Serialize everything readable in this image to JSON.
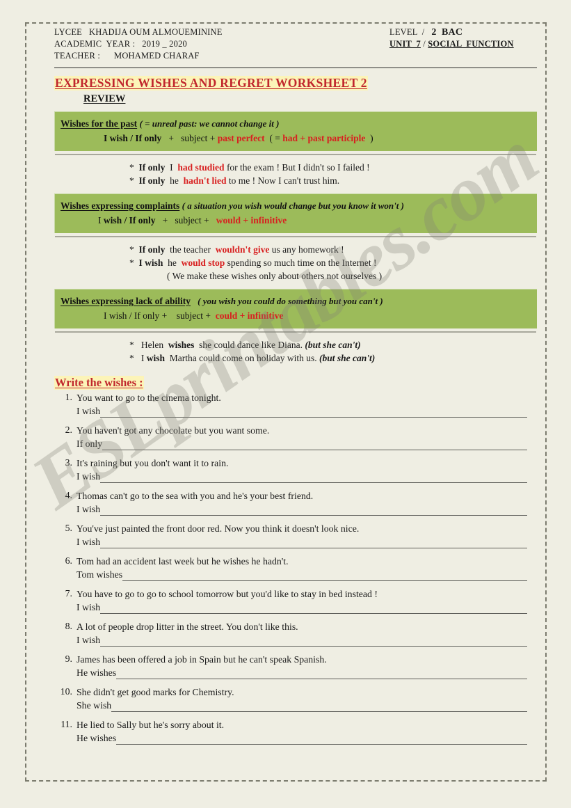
{
  "watermark": {
    "text": "ESLprintables.com"
  },
  "header": {
    "school_label": "LYCEE   KHADIJA OUM ALMOUEMININE",
    "year_label": "ACADEMIC  YEAR :",
    "year_value": "2019 _ 2020",
    "teacher_label": "TEACHER :",
    "teacher_value": "MOHAMED CHARAF",
    "level_label": "LEVEL  /",
    "level_value": "2  BAC",
    "unit_label": "UNIT  7",
    "unit_sep": "/",
    "unit_value": "SOCIAL  FUNCTION"
  },
  "titles": {
    "worksheet": "EXPRESSING  WISHES  AND REGRET  WORKSHEET   2",
    "review": "REVIEW",
    "write": "Write the wishes :"
  },
  "colors": {
    "page_background": "#efeee3",
    "green_box": "#9cbb5a",
    "highlight_yellow": "#fcf4b8",
    "title_red": "#c1272d",
    "accent_red": "#d82020",
    "ink": "#1a1a1a"
  },
  "boxes": [
    {
      "term": "Wishes for the past",
      "paren": "(  =  unreal past: we cannot change it  )",
      "formula_pre": "I wish / If only",
      "formula_plus1": "+",
      "formula_subject": "subject +",
      "formula_red1": "past perfect",
      "formula_mid": "(  =",
      "formula_red2": "had + past participle",
      "formula_close": ")",
      "examples": [
        {
          "star": "*",
          "bold1": "If only",
          "mid1": "I",
          "red": "had studied",
          "rest": "for the exam !    But I didn't so I failed !"
        },
        {
          "star": "*",
          "bold1": "If only",
          "mid1": "he",
          "red": "hadn't lied",
          "rest": "to me !    Now I can't trust him."
        }
      ],
      "note": ""
    },
    {
      "term": "Wishes expressing complaints",
      "paren": "( a situation you wish would change but you know it won't )",
      "formula_pre": "I wish / If only",
      "formula_plus1": "+",
      "formula_subject": "subject +",
      "formula_red1": "would + infinitive",
      "formula_mid": "",
      "formula_red2": "",
      "formula_close": "",
      "examples": [
        {
          "star": "*",
          "bold1": "If only",
          "mid1": "the teacher",
          "red": "wouldn't give",
          "rest": "us any homework  !"
        },
        {
          "star": "*",
          "bold1": "I wish",
          "mid1": "he",
          "red": "would stop",
          "rest": "spending so much time on the Internet  !"
        }
      ],
      "note": "(  We make these wishes only about others not ourselves   )"
    },
    {
      "term": "Wishes expressing lack of ability",
      "paren": "( you wish you could do something but you can't  )",
      "formula_pre": "I wish / If only +",
      "formula_plus1": "",
      "formula_subject": "subject   +",
      "formula_red1": "could  + infinitive",
      "formula_mid": "",
      "formula_red2": "",
      "formula_close": "",
      "examples": [
        {
          "star": "*",
          "bold1": "",
          "mid1": "Helen",
          "bold2": "wishes",
          "rest": "she could dance like Diana.",
          "italic": "(but she can't)"
        },
        {
          "star": "*",
          "bold1": "",
          "mid1": "I",
          "bold2": "wish",
          "rest": "Martha could come on holiday with us.",
          "italic": "(but she can't)"
        }
      ],
      "note": ""
    }
  ],
  "exercises": [
    {
      "num": "1.",
      "prompt": "You want to go to the cinema tonight.",
      "lead": "I wish"
    },
    {
      "num": "2.",
      "prompt": "You haven't got any chocolate but you want some.",
      "lead": "If only"
    },
    {
      "num": "3.",
      "prompt": "It's raining but you don't want it to rain.",
      "lead": "I wish"
    },
    {
      "num": "4.",
      "prompt": "Thomas can't go to the sea with you and he's your best friend.",
      "lead": "I wish"
    },
    {
      "num": "5.",
      "prompt": "You've just painted the front door red.  Now you think it doesn't look nice.",
      "lead": "I wish"
    },
    {
      "num": "6.",
      "prompt": "Tom had an accident last week but he wishes he hadn't.",
      "lead": "Tom wishes"
    },
    {
      "num": "7.",
      "prompt": "You have to go to go to school tomorrow but you'd like to stay in bed instead !",
      "lead": "I wish"
    },
    {
      "num": "8.",
      "prompt": "A lot of people drop litter in the street.  You don't like this.",
      "lead": "I wish"
    },
    {
      "num": "9.",
      "prompt": "James has been offered a job in Spain but he can't speak Spanish.",
      "lead": "He wishes"
    },
    {
      "num": "10.",
      "prompt": "She didn't get good marks for Chemistry.",
      "lead": "She wish"
    },
    {
      "num": "11.",
      "prompt": "He lied to Sally but he's sorry about it.",
      "lead": "He wishes"
    }
  ]
}
